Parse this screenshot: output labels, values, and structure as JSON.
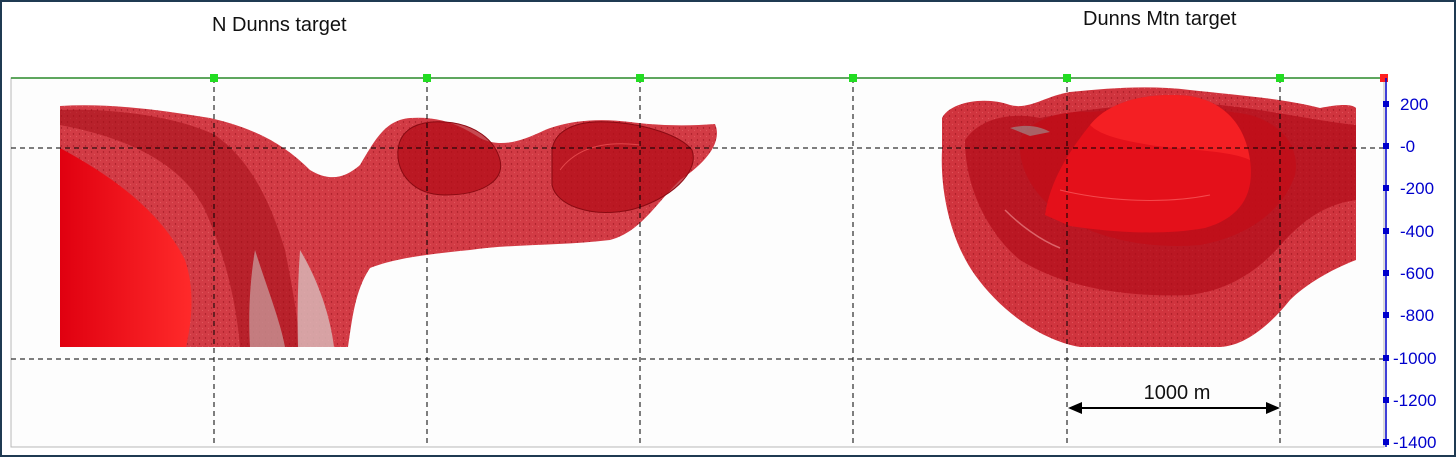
{
  "labels": {
    "left_target": "N Dunns target",
    "right_target": "Dunns Mtn target",
    "scale_bar": "1000 m"
  },
  "axis": {
    "ticks": [
      "200",
      "-0",
      "-200",
      "-400",
      "-600",
      "-800",
      "-1000",
      "-1200",
      "-1400"
    ],
    "color": "#0000cc"
  },
  "colors": {
    "body_red": "#d01018",
    "body_red_light": "#e8454b",
    "grid_line": "#000000",
    "marker_green": "#22dd22",
    "marker_red": "#ff2020"
  }
}
